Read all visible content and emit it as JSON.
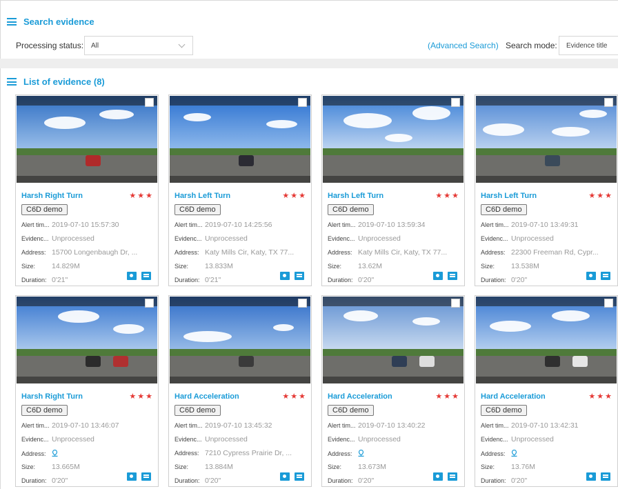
{
  "search_section": {
    "title": "Search evidence",
    "processing_status_label": "Processing status:",
    "processing_status_value": "All",
    "advanced_search": "(Advanced Search)",
    "search_mode_label": "Search mode:",
    "search_mode_value": "Evidence title"
  },
  "list_section": {
    "title": "List of evidence (8)"
  },
  "field_labels": {
    "alert_time": "Alert tim...",
    "evidence": "Evidenc...",
    "address": "Address:",
    "size": "Size:",
    "duration": "Duration:"
  },
  "icons": {
    "menu": "menu-icon",
    "camera": "camera-icon",
    "document": "document-icon",
    "location": "location-pin-icon",
    "checkbox": "checkbox"
  },
  "colors": {
    "accent": "#1a9bd7",
    "stars": "#e53935"
  },
  "cards": [
    {
      "title": "Harsh Right Turn",
      "stars": "★★★",
      "tag": "C6D demo",
      "alert_time": "2019-07-10 15:57:30",
      "status": "Unprocessed",
      "address": "15700 Longenbaugh Dr, ...",
      "address_icon": false,
      "size": "14.829M",
      "duration": "0'21\""
    },
    {
      "title": "Harsh Left Turn",
      "stars": "★★★",
      "tag": "C6D demo",
      "alert_time": "2019-07-10 14:25:56",
      "status": "Unprocessed",
      "address": "Katy Mills Cir, Katy, TX 77...",
      "address_icon": false,
      "size": "13.833M",
      "duration": "0'21\""
    },
    {
      "title": "Harsh Left Turn",
      "stars": "★★★",
      "tag": "C6D demo",
      "alert_time": "2019-07-10 13:59:34",
      "status": "Unprocessed",
      "address": "Katy Mills Cir, Katy, TX 77...",
      "address_icon": false,
      "size": "13.62M",
      "duration": "0'20\""
    },
    {
      "title": "Harsh Left Turn",
      "stars": "★★★",
      "tag": "C6D demo",
      "alert_time": "2019-07-10 13:49:31",
      "status": "Unprocessed",
      "address": "22300 Freeman Rd, Cypr...",
      "address_icon": false,
      "size": "13.538M",
      "duration": "0'20\""
    },
    {
      "title": "Harsh Right Turn",
      "stars": "★★★",
      "tag": "C6D demo",
      "alert_time": "2019-07-10 13:46:07",
      "status": "Unprocessed",
      "address": "",
      "address_icon": true,
      "size": "13.665M",
      "duration": "0'20\""
    },
    {
      "title": "Hard Acceleration",
      "stars": "★★★",
      "tag": "C6D demo",
      "alert_time": "2019-07-10 13:45:32",
      "status": "Unprocessed",
      "address": "7210 Cypress Prairie Dr, ...",
      "address_icon": false,
      "size": "13.884M",
      "duration": "0'20\""
    },
    {
      "title": "Hard Acceleration",
      "stars": "★★★",
      "tag": "C6D demo",
      "alert_time": "2019-07-10 13:40:22",
      "status": "Unprocessed",
      "address": "",
      "address_icon": true,
      "size": "13.673M",
      "duration": "0'20\""
    },
    {
      "title": "Hard Acceleration",
      "stars": "★★★",
      "tag": "C6D demo",
      "alert_time": "2019-07-10 13:42:31",
      "status": "Unprocessed",
      "address": "",
      "address_icon": true,
      "size": "13.76M",
      "duration": "0'20\""
    }
  ]
}
